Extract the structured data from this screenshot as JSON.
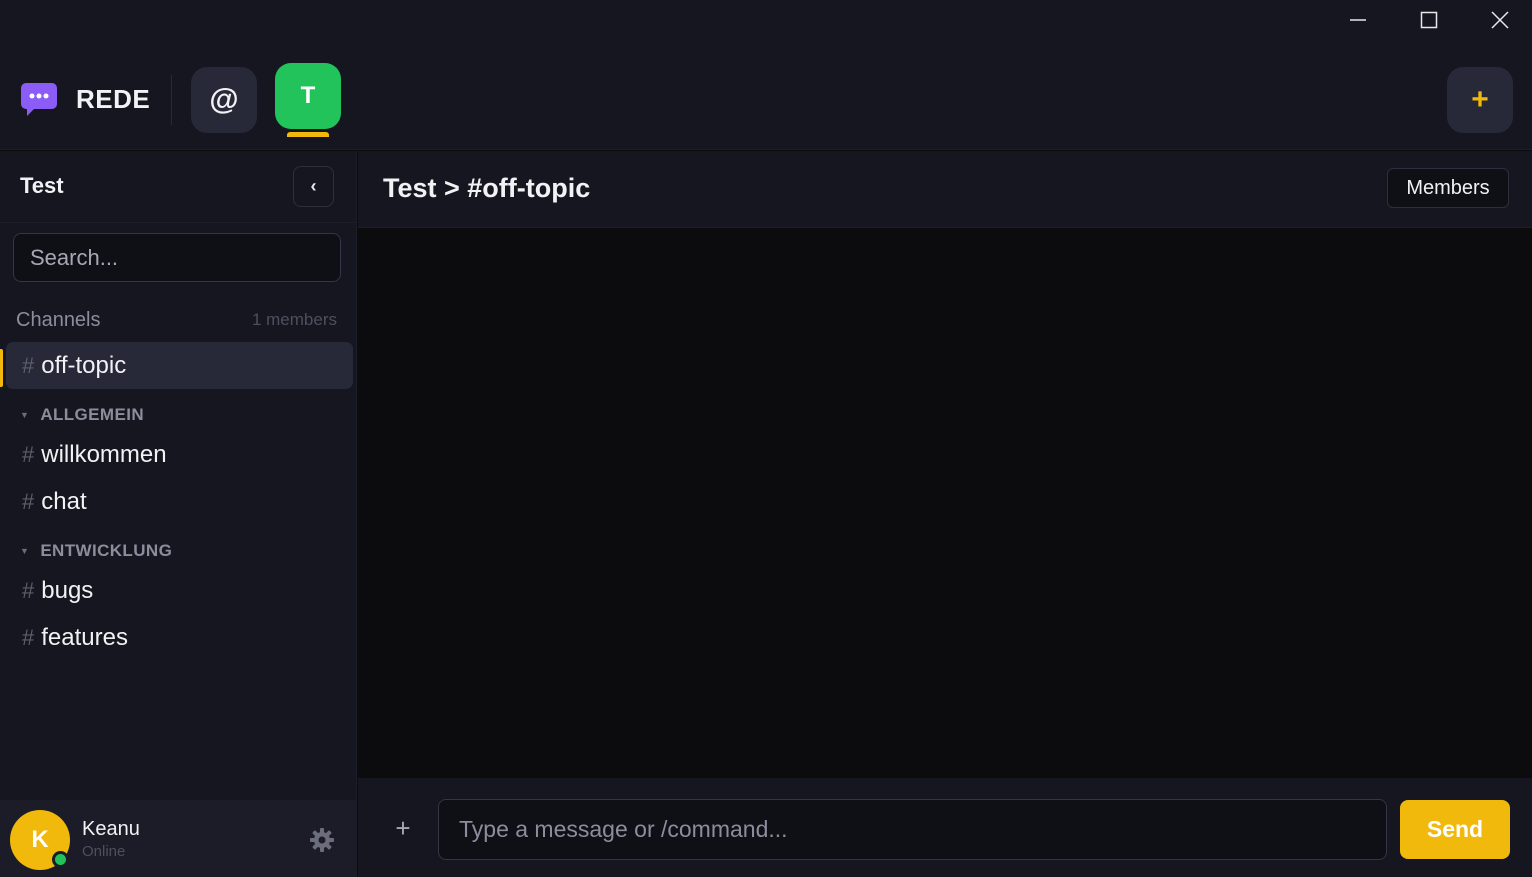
{
  "window": {
    "controls": [
      "minimize-icon",
      "maximize-icon",
      "close-icon"
    ]
  },
  "brand": {
    "name": "REDE",
    "icon": "chat-bubble-icon",
    "icon_color": "#8b5cf6"
  },
  "servers": [
    {
      "label": "@",
      "kind": "direct-messages"
    },
    {
      "label": "T",
      "kind": "server",
      "color": "#23c35c",
      "selected": true
    }
  ],
  "add_server": {
    "label": "+"
  },
  "sidebar": {
    "server_title": "Test",
    "collapse_label": "‹",
    "search_placeholder": "Search...",
    "channels_label": "Channels",
    "members_count": "1 members",
    "channels": [
      {
        "name": "off-topic",
        "active": true
      }
    ],
    "categories": [
      {
        "name": "ALLGEMEIN",
        "channels": [
          {
            "name": "willkommen"
          },
          {
            "name": "chat"
          }
        ]
      },
      {
        "name": "ENTWICKLUNG",
        "channels": [
          {
            "name": "bugs"
          },
          {
            "name": "features"
          }
        ]
      }
    ],
    "hash_symbol": "#"
  },
  "user": {
    "initial": "K",
    "name": "Keanu",
    "status": "Online",
    "avatar_color": "#f0b90b",
    "status_color": "#23c35c"
  },
  "main": {
    "breadcrumb": "Test > #off-topic",
    "members_button": "Members",
    "composer": {
      "attach_label": "+",
      "placeholder": "Type a message or /command...",
      "send_label": "Send"
    }
  },
  "colors": {
    "accent": "#f0b90b",
    "success": "#23c35c",
    "background": "#0c0c0f",
    "panel": "#15161f"
  }
}
